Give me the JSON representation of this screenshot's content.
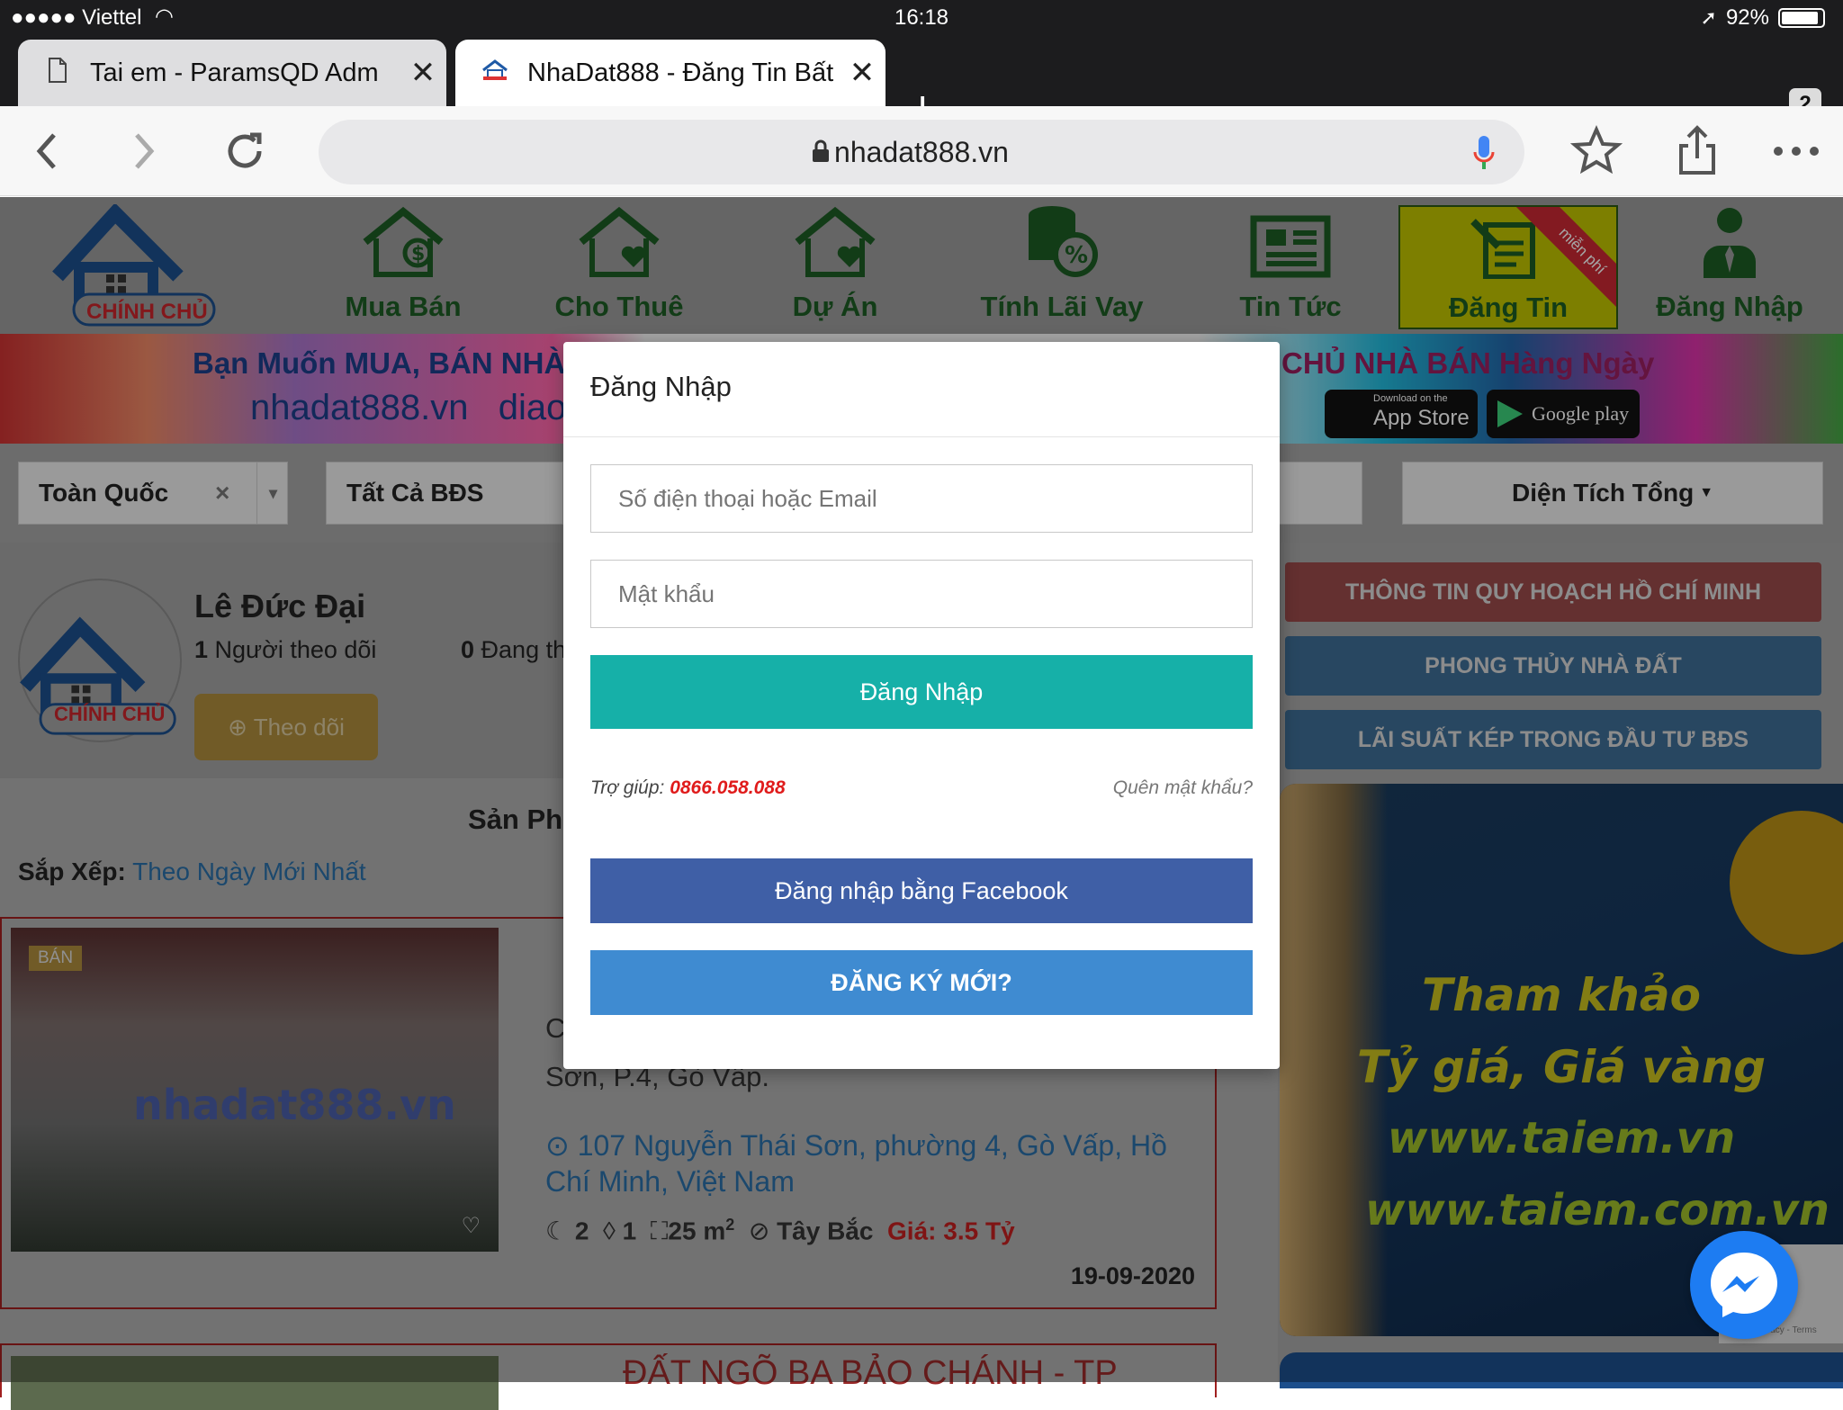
{
  "status": {
    "carrier": "●●●●● Viettel",
    "time": "16:18",
    "battery": "92%",
    "battery_level": 0.92
  },
  "tabs": [
    {
      "title": "Tai em - ParamsQD Adm"
    },
    {
      "title": "NhaDat888 - Đăng Tin Bất Đ"
    }
  ],
  "tab_count": "2",
  "url": "nhadat888.vn",
  "site_nav": {
    "logo_text": "CHÍNH CHỦ",
    "items": [
      "Mua Bán",
      "Cho Thuê",
      "Dự Án",
      "Tính Lãi Vay",
      "Tin Tức",
      "Đăng Tin",
      "Đăng Nhập"
    ],
    "free_badge": "miễn phí"
  },
  "banner": {
    "left_line1": "Bạn Muốn MUA, BÁN NHÀ C",
    "left_line2": "nhadat888.vn   diao",
    "right_line1": "CHỦ NHÀ BÁN Hàng Ngày",
    "appstore": "App Store",
    "appstore_small": "Download on the",
    "googleplay": "Google play"
  },
  "filters": {
    "region": "Toàn Quốc",
    "type": "Tất Cả BĐS",
    "area": "Diện Tích Tổng"
  },
  "profile": {
    "name": "Lê Đức Đại",
    "followers_count": "1",
    "followers_label": "Người theo dõi",
    "posting_count": "0",
    "posting_label": "Đang th",
    "follow_btn": "Theo dõi"
  },
  "content": {
    "heading": "Sản Ph",
    "sort_label": "Sắp Xếp:",
    "sort_value": "Theo Ngày Mới Nhất"
  },
  "listing": {
    "badge": "BÁN",
    "watermark": "nhadat888.vn",
    "desc_partial": "C",
    "desc_partial2": "Sơn, P.4, Gò Vấp.",
    "address": "107 Nguyễn Thái Sơn, phường 4, Gò Vấp, Hồ Chí Minh, Việt Nam",
    "bedrooms": "2",
    "bathrooms": "1",
    "area": "25 m",
    "area_sup": "2",
    "direction": "Tây Bắc",
    "price": "Giá: 3.5 Tỷ",
    "date": "19-09-2020",
    "next_title": "ĐẤT NGÕ BA BẢO CHÁNH - TP"
  },
  "sidebar": {
    "buttons": [
      "THÔNG TIN QUY HOẠCH HỒ CHÍ MINH",
      "PHONG THỦY NHÀ ĐẤT",
      "LÃI SUẤT KÉP TRONG ĐẦU TƯ BĐS"
    ],
    "ad_lines": [
      "Tham khảo",
      "Tỷ giá, Giá vàng",
      "www.taiem.vn",
      "www.taiem.com.vn"
    ],
    "recaptcha": "Privacy - Terms"
  },
  "modal": {
    "title": "Đăng Nhập",
    "phone_placeholder": "Số điện thoại hoặc Email",
    "password_placeholder": "Mật khẩu",
    "login_btn": "Đăng Nhập",
    "help_label": "Trợ giúp:",
    "help_phone": "0866.058.088",
    "forgot": "Quên mật khẩu?",
    "facebook_btn": "Đăng nhập bằng Facebook",
    "register_btn": "ĐĂNG KÝ MỚI?"
  },
  "colors": {
    "nav_green": "#1c5c24",
    "login_teal": "#16b0a8",
    "facebook": "#3f5fa6",
    "register": "#3f8bd1",
    "help_red": "#e01b1b"
  }
}
